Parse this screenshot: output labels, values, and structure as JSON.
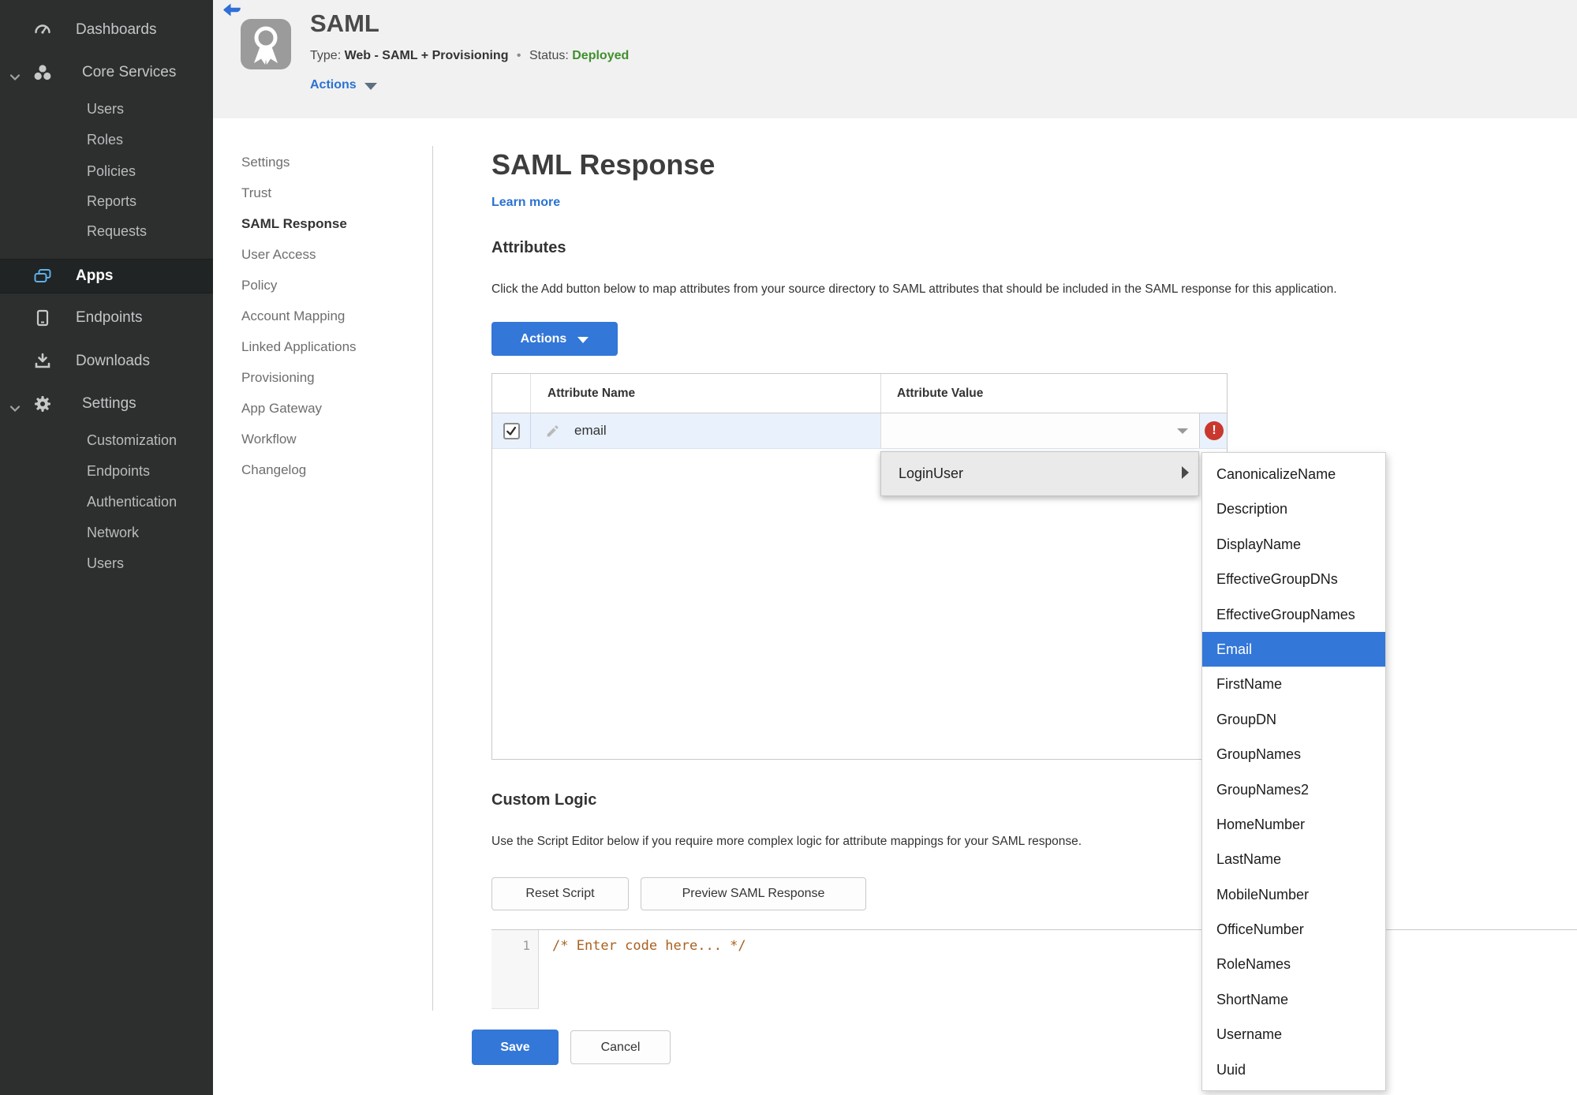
{
  "colors": {
    "accent_blue": "#3377d8",
    "link_blue": "#2a72d4",
    "status_green": "#3f8f2f",
    "error_red": "#c9382e",
    "row_highlight": "#e9f1fc",
    "sidebar_bg": "#2d2f2f"
  },
  "sidebar": {
    "items": [
      {
        "label": "Dashboards",
        "icon": "gauge-icon"
      },
      {
        "label": "Core Services",
        "icon": "core-services-icon",
        "expanded": true,
        "children": [
          "Users",
          "Roles",
          "Policies",
          "Reports",
          "Requests"
        ]
      },
      {
        "label": "Apps",
        "icon": "apps-icon",
        "active": true
      },
      {
        "label": "Endpoints",
        "icon": "endpoints-icon"
      },
      {
        "label": "Downloads",
        "icon": "downloads-icon"
      },
      {
        "label": "Settings",
        "icon": "gear-icon",
        "expanded": true,
        "children": [
          "Customization",
          "Endpoints",
          "Authentication",
          "Network",
          "Users"
        ]
      }
    ]
  },
  "header": {
    "app_title": "SAML",
    "type_label": "Type:",
    "type_value": "Web - SAML + Provisioning",
    "separator": "•",
    "status_label": "Status:",
    "status_value": "Deployed",
    "actions_label": "Actions"
  },
  "subnav": {
    "active": "SAML Response",
    "items": [
      "Settings",
      "Trust",
      "SAML Response",
      "User Access",
      "Policy",
      "Account Mapping",
      "Linked Applications",
      "Provisioning",
      "App Gateway",
      "Workflow",
      "Changelog"
    ]
  },
  "main": {
    "title": "SAML Response",
    "learn_more": "Learn more",
    "attributes": {
      "heading": "Attributes",
      "description": "Click the Add button below to map attributes from your source directory to SAML attributes that should be included in the SAML response for this application.",
      "actions_button": "Actions",
      "table": {
        "columns": {
          "name": "Attribute Name",
          "value": "Attribute Value"
        },
        "row": {
          "checked": true,
          "attribute_name": "email",
          "attribute_value": "",
          "error": "!"
        }
      }
    },
    "value_menu": {
      "label": "LoginUser",
      "selected": "Email",
      "submenu": [
        "CanonicalizeName",
        "Description",
        "DisplayName",
        "EffectiveGroupDNs",
        "EffectiveGroupNames",
        "Email",
        "FirstName",
        "GroupDN",
        "GroupNames",
        "GroupNames2",
        "HomeNumber",
        "LastName",
        "MobileNumber",
        "OfficeNumber",
        "RoleNames",
        "ShortName",
        "Username",
        "Uuid"
      ]
    },
    "custom_logic": {
      "heading": "Custom Logic",
      "description": "Use the Script Editor below if you require more complex logic for attribute mappings for your SAML response.",
      "reset_button": "Reset Script",
      "preview_button": "Preview SAML Response",
      "editor": {
        "line_number": "1",
        "code": "/* Enter code here... */"
      }
    },
    "save_button": "Save",
    "cancel_button": "Cancel"
  }
}
